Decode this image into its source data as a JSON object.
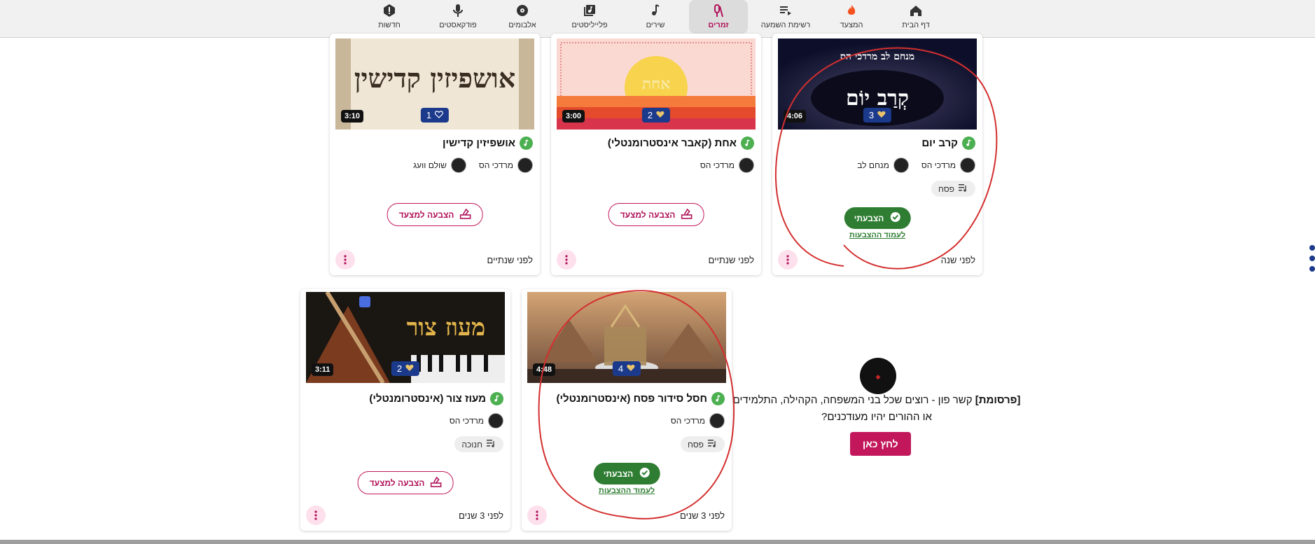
{
  "nav": {
    "items": [
      {
        "label": "דף הבית",
        "icon": "home-icon"
      },
      {
        "label": "המצעד",
        "icon": "fire-icon"
      },
      {
        "label": "רשימת השמעה",
        "icon": "playlist-play-icon"
      },
      {
        "label": "זמרים",
        "icon": "microphone-stand-icon",
        "active": true
      },
      {
        "label": "שירים",
        "icon": "music-note-icon"
      },
      {
        "label": "פלייליסטים",
        "icon": "library-music-icon"
      },
      {
        "label": "אלבומים",
        "icon": "album-icon"
      },
      {
        "label": "פודקאסטים",
        "icon": "microphone-icon"
      },
      {
        "label": "חדשות",
        "icon": "alert-icon"
      }
    ]
  },
  "cards": [
    {
      "title": "קרב יום",
      "duration": "4:06",
      "likes": "3",
      "liked": true,
      "artists": [
        "מרדכי הס",
        "מנחם לב"
      ],
      "chip": "פסח",
      "voted": true,
      "voted_label": "הצבעתי",
      "voted_link": "לעמוד ההצבעות",
      "time": "לפני שנה"
    },
    {
      "title": "אחת (קאבר אינסטרומנטלי)",
      "duration": "3:00",
      "likes": "2",
      "liked": true,
      "artists": [
        "מרדכי הס"
      ],
      "chip": "",
      "voted": false,
      "vote_label": "הצבעה למצעד",
      "time": "לפני שנתיים"
    },
    {
      "title": "אושפיזין קדישין",
      "duration": "3:10",
      "likes": "1",
      "liked": false,
      "artists": [
        "מרדכי הס",
        "שולם וועג"
      ],
      "chip": "",
      "voted": false,
      "vote_label": "הצבעה למצעד",
      "time": "לפני שנתיים"
    },
    {
      "title": "חסל סידור פסח (אינסטרומנטלי)",
      "duration": "4:48",
      "likes": "4",
      "liked": true,
      "artists": [
        "מרדכי הס"
      ],
      "chip": "פסח",
      "voted": true,
      "voted_label": "הצבעתי",
      "voted_link": "לעמוד ההצבעות",
      "time": "לפני 3 שנים"
    },
    {
      "title": "מעוז צור (אינסטרומנטלי)",
      "duration": "3:11",
      "likes": "2",
      "liked": true,
      "artists": [
        "מרדכי הס"
      ],
      "chip": "חנוכה",
      "voted": false,
      "vote_label": "הצבעה למצעד",
      "time": "לפני 3 שנים"
    }
  ],
  "thumb_text": {
    "card1_top": "מנחם לב  מרדכי הס",
    "card1_main": "קְרַב יוֹם",
    "card2_main": "אחת",
    "card3_main": "אושפיזין קדישין",
    "card4_main": "",
    "card5_main": "מעוז צור"
  },
  "ad": {
    "tag": "[פרסומת]",
    "text": "קשר פון - רוצים שכל בני המשפחה, הקהילה, התלמידים או ההורים יהיו מעודכנים?",
    "button": "לחץ כאן"
  },
  "colors": {
    "accent": "#b0115a",
    "voted": "#2e7d32",
    "likes": "#1c3a8c",
    "note": "#4caf50",
    "annotation": "#d32f2f"
  }
}
